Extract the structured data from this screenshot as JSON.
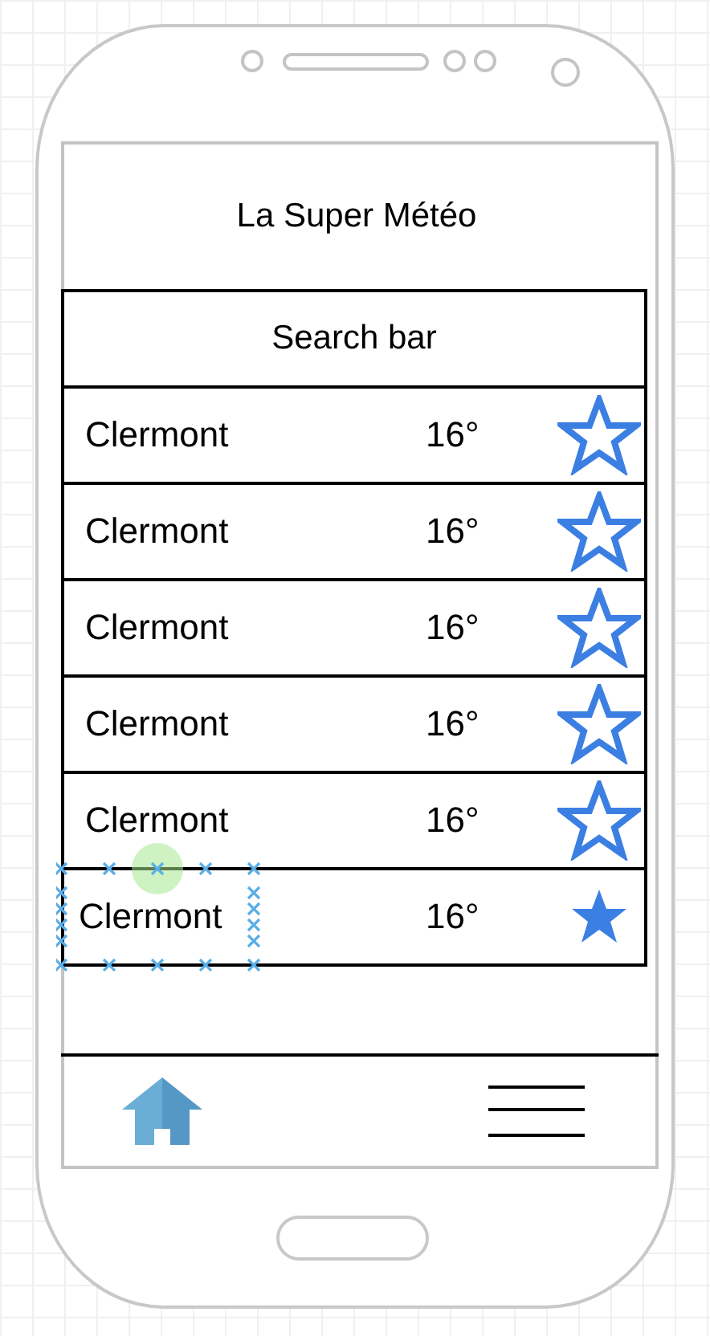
{
  "app_title": "La Super Météo",
  "search": {
    "placeholder": "Search bar"
  },
  "cities": [
    {
      "name": "Clermont",
      "temperature": "16°",
      "favorite": false,
      "selected": false
    },
    {
      "name": "Clermont",
      "temperature": "16°",
      "favorite": false,
      "selected": false
    },
    {
      "name": "Clermont",
      "temperature": "16°",
      "favorite": false,
      "selected": false
    },
    {
      "name": "Clermont",
      "temperature": "16°",
      "favorite": false,
      "selected": false
    },
    {
      "name": "Clermont",
      "temperature": "16°",
      "favorite": false,
      "selected": false
    },
    {
      "name": "Clermont",
      "temperature": "16°",
      "favorite": true,
      "selected": true
    }
  ]
}
